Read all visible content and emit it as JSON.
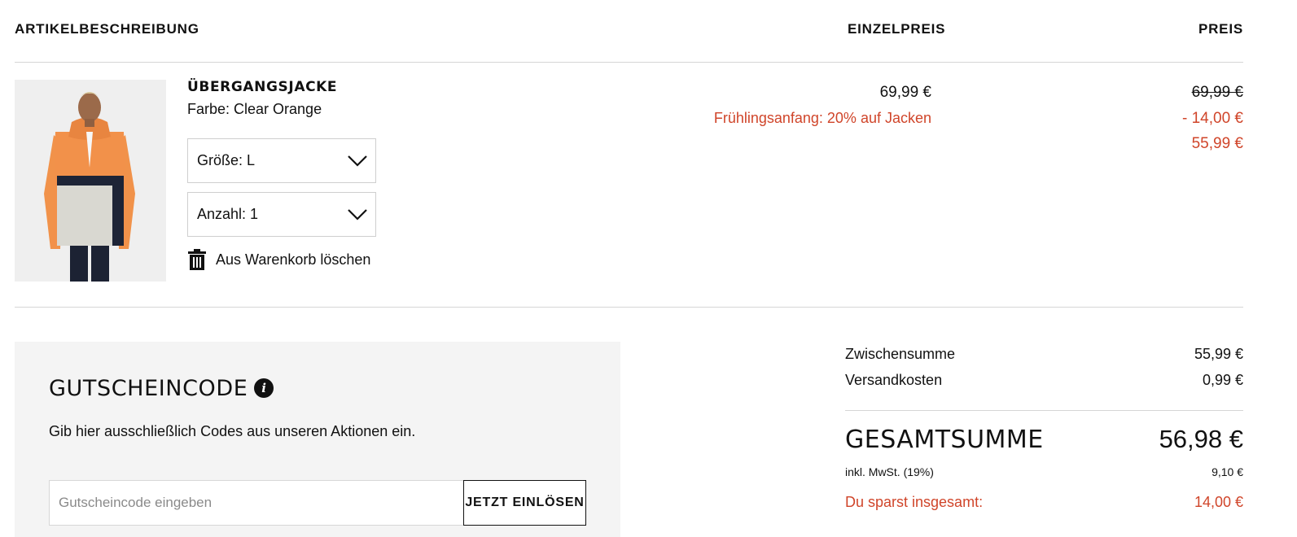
{
  "table_header": {
    "description": "ARTIKELBESCHREIBUNG",
    "unit_price": "EINZELPREIS",
    "price": "PREIS"
  },
  "item": {
    "name": "ÜBERGANGSJACKE",
    "color": "Farbe: Clear Orange",
    "size_select": "Größe: L",
    "quantity_select": "Anzahl: 1",
    "remove_label": "Aus Warenkorb löschen",
    "unit_price": "69,99 €",
    "promo_label": "Frühlingsanfang: 20% auf Jacken",
    "original_price": "69,99 €",
    "discount": "- 14,00 €",
    "final_price": "55,99 €",
    "image_alt": "product-photo-orange-jacket"
  },
  "voucher": {
    "title": "GUTSCHEINCODE",
    "hint": "Gib hier ausschließlich Codes aus unseren Aktionen ein.",
    "input_placeholder": "Gutscheincode eingeben",
    "button": "JETZT EINLÖSEN"
  },
  "summary": {
    "subtotal_label": "Zwischensumme",
    "subtotal_value": "55,99 €",
    "shipping_label": "Versandkosten",
    "shipping_value": "0,99 €",
    "total_label": "GESAMTSUMME",
    "total_value": "56,98 €",
    "vat_label": "inkl. MwSt. (19%)",
    "vat_value": "9,10 €",
    "savings_label": "Du sparst insgesamt:",
    "savings_value": "14,00 €"
  },
  "colors": {
    "accent_red": "#d0452a",
    "panel_bg": "#f4f4f4",
    "rule": "#d6d6d6"
  }
}
